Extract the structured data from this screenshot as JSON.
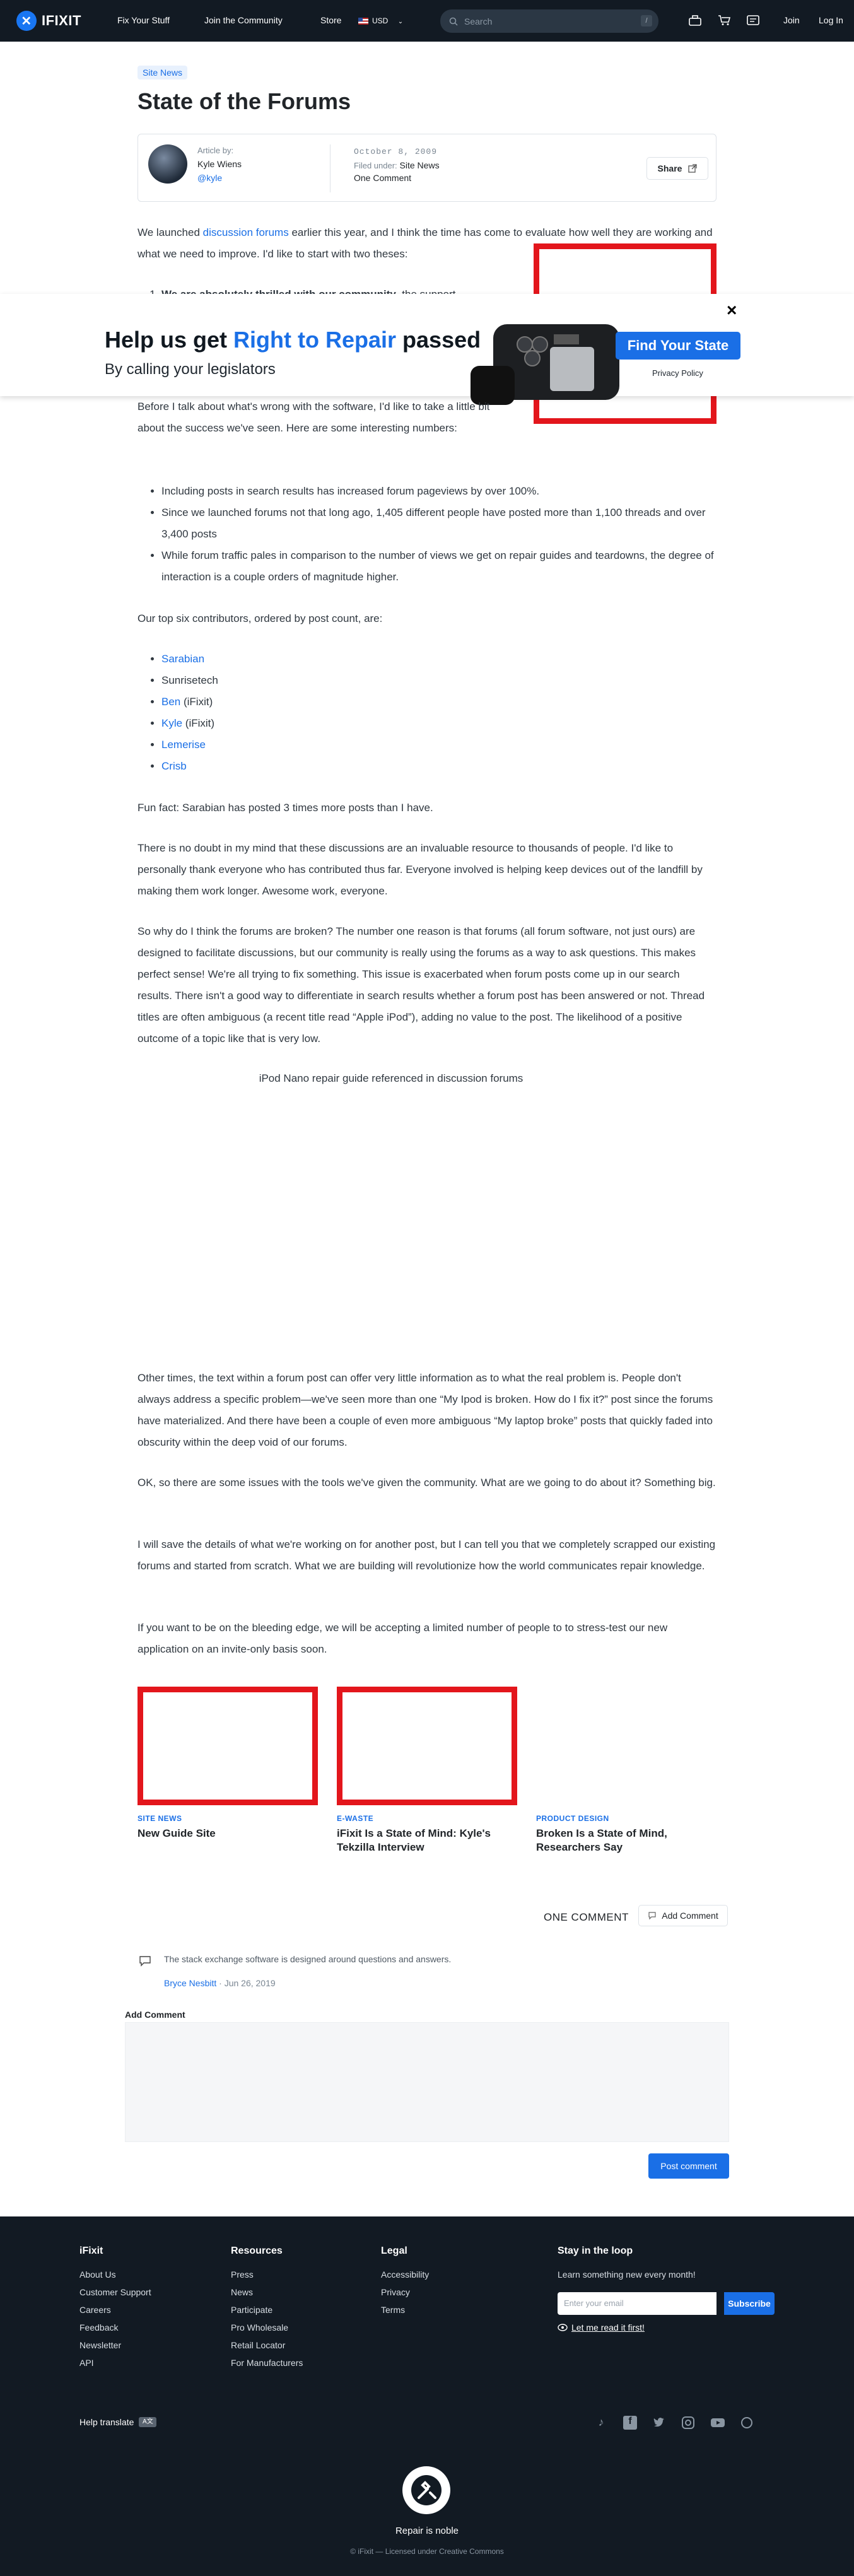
{
  "nav": {
    "brand": "IFIXIT",
    "links": [
      "Fix Your Stuff",
      "Join the Community",
      "Store"
    ],
    "currency": "USD",
    "search_placeholder": "Search",
    "search_shortcut": "/",
    "join": "Join",
    "login": "Log In"
  },
  "article": {
    "category": "Site News",
    "title": "State of the Forums",
    "author_label": "Article by:",
    "author_name": "Kyle Wiens",
    "author_handle": "@kyle",
    "date": "October 8, 2009",
    "filed_label": "Filed under:",
    "filed_value": "Site News",
    "comment_count": "One Comment",
    "share": "Share",
    "intro_a": "We launched ",
    "intro_link": "discussion forums",
    "intro_b": " earlier this year, and I think the time has come to evaluate how well they are working and what we need to improve. I'd like to start with two theses:",
    "thesis_bold": "We are absolutely thrilled with our community",
    "thesis_rest": ", the support",
    "before_p": "Before I talk about what's wrong with the software, I'd like to take a little bit about the success we've seen. Here are some interesting numbers:",
    "stats": [
      "Including posts in search results has increased forum pageviews by over 100%.",
      "Since we launched forums not that long ago, 1,405 different people have posted more than 1,100 threads and over 3,400 posts",
      "While forum traffic pales in comparison to the number of views we get on repair guides and teardowns, the degree of interaction is a couple orders of magnitude higher."
    ],
    "contrib_intro": "Our top six contributors, ordered by post count, are:",
    "contributors": [
      {
        "name": "Sarabian",
        "suffix": "",
        "link": true
      },
      {
        "name": "Sunrisetech",
        "suffix": "",
        "link": false
      },
      {
        "name": "Ben",
        "suffix": " (iFixit)",
        "link": true
      },
      {
        "name": "Kyle",
        "suffix": " (iFixit)",
        "link": true
      },
      {
        "name": "Lemerise",
        "suffix": "",
        "link": true
      },
      {
        "name": "Crisb",
        "suffix": "",
        "link": true
      }
    ],
    "funfact": "Fun fact: Sarabian has posted 3 times more posts than I have.",
    "p_thanks": "There is no doubt in my mind that these discussions are an invaluable resource to thousands of people. I'd like to personally thank everyone who has contributed thus far. Everyone involved is helping keep devices out of the landfill by making them work longer. Awesome work, everyone.",
    "p_broken": "So why do I think the forums are broken? The number one reason is that forums (all forum software, not just ours) are designed to facilitate discussions, but our community is really using the forums as a way to ask questions. This makes perfect sense! We're all trying to fix something. This issue is exacerbated when forum posts come up in our search results. There isn't a good way to differentiate in search results whether a forum post has been answered or not. Thread titles are often ambiguous (a recent title read “Apple iPod”), adding no value to the post. The likelihood of a positive outcome of a topic like that is very low.",
    "image_caption": "iPod Nano repair guide referenced in discussion forums",
    "p_other": "Other times, the text within a forum post can offer very little information as to what the real problem is. People don't always address a specific problem—we've seen more than one “My Ipod is broken. How do I fix it?” post since the forums have materialized. And there have been a couple of even more ambiguous “My laptop broke” posts that quickly faded into obscurity within the deep void of our forums.",
    "p_ok": "OK, so there are some issues with the tools we've given the community. What are we going to do about it? Something big.",
    "p_save": "I will save the details of what we're working on for another post, but I can tell you that we completely scrapped our existing forums and started from scratch. What we are building will revolutionize how the world communicates repair knowledge.",
    "p_bleed": "If you want to be on the bleeding edge, we will be accepting a limited number of people to to stress-test our new application on an invite-only basis soon."
  },
  "modal": {
    "headline_a": "Help us get ",
    "headline_hl": "Right to Repair",
    "headline_b": " passed",
    "subline": "By calling your legislators",
    "button": "Find Your State",
    "privacy": "Privacy Policy",
    "close": "×"
  },
  "related": [
    {
      "category": "SITE NEWS",
      "title": "New Guide Site"
    },
    {
      "category": "E-WASTE",
      "title": "iFixit Is a State of Mind: Kyle's Tekzilla Interview"
    },
    {
      "category": "PRODUCT DESIGN",
      "title": "Broken Is a State of Mind, Researchers Say"
    }
  ],
  "comments": {
    "header": "ONE COMMENT",
    "add_button": "Add Comment",
    "items": [
      {
        "text": "The stack exchange software is designed around questions and answers.",
        "author": "Bryce Nesbitt",
        "date": "Jun 26, 2019"
      }
    ],
    "form_label": "Add Comment",
    "post_button": "Post comment"
  },
  "footer": {
    "columns": [
      {
        "title": "iFixit",
        "items": [
          "About Us",
          "Customer Support",
          "Careers",
          "Feedback",
          "Newsletter",
          "API"
        ]
      },
      {
        "title": "Resources",
        "items": [
          "Press",
          "News",
          "Participate",
          "Pro Wholesale",
          "Retail Locator",
          "For Manufacturers"
        ]
      },
      {
        "title": "Legal",
        "items": [
          "Accessibility",
          "Privacy",
          "Terms"
        ]
      }
    ],
    "newsletter_title": "Stay in the loop",
    "newsletter_text": "Learn something new every month!",
    "email_placeholder": "Enter your email",
    "subscribe": "Subscribe",
    "read_it": "Let me read it first!",
    "help_translate": "Help translate",
    "tagline": "Repair is noble",
    "license": "© iFixit — Licensed under Creative Commons"
  }
}
